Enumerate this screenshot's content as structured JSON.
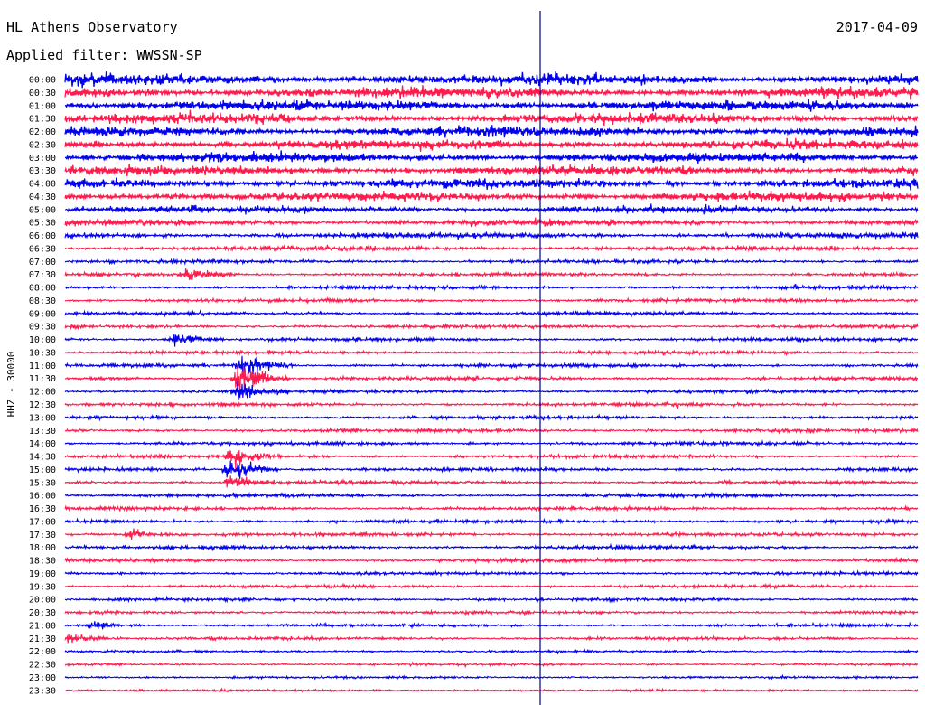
{
  "header": {
    "station": "HL Athens Observatory",
    "date": "2017-04-09",
    "filter": "Applied filter: WWSSN-SP"
  },
  "chart_data": {
    "type": "seismogram",
    "ylabel": "HHZ - 30000",
    "row_labels": [
      "00:00",
      "00:30",
      "01:00",
      "01:30",
      "02:00",
      "02:30",
      "03:00",
      "03:30",
      "04:00",
      "04:30",
      "05:00",
      "05:30",
      "06:00",
      "06:30",
      "07:00",
      "07:30",
      "08:00",
      "08:30",
      "09:00",
      "09:30",
      "10:00",
      "10:30",
      "11:00",
      "11:30",
      "12:00",
      "12:30",
      "13:00",
      "13:30",
      "14:00",
      "14:30",
      "15:00",
      "15:30",
      "16:00",
      "16:30",
      "17:00",
      "17:30",
      "18:00",
      "18:30",
      "19:00",
      "19:30",
      "20:00",
      "20:30",
      "21:00",
      "21:30",
      "22:00",
      "22:30",
      "23:00",
      "23:30"
    ],
    "colors": {
      "even": "#0000ee",
      "odd": "#ff1a4d",
      "marker": "#000088"
    },
    "events": [
      {
        "row": 15,
        "minute": 4.3,
        "amplitude": 2.2
      },
      {
        "row": 20,
        "minute": 3.9,
        "amplitude": 1.8
      },
      {
        "row": 22,
        "minute": 6.2,
        "amplitude": 3.5
      },
      {
        "row": 23,
        "minute": 6.1,
        "amplitude": 5.0
      },
      {
        "row": 24,
        "minute": 6.1,
        "amplitude": 2.6
      },
      {
        "row": 29,
        "minute": 5.8,
        "amplitude": 2.5
      },
      {
        "row": 30,
        "minute": 5.8,
        "amplitude": 4.0
      },
      {
        "row": 31,
        "minute": 5.8,
        "amplitude": 1.8
      },
      {
        "row": 35,
        "minute": 2.3,
        "amplitude": 1.6
      },
      {
        "row": 42,
        "minute": 1.0,
        "amplitude": 1.4
      },
      {
        "row": 43,
        "minute": 0.1,
        "amplitude": 1.8
      }
    ]
  }
}
